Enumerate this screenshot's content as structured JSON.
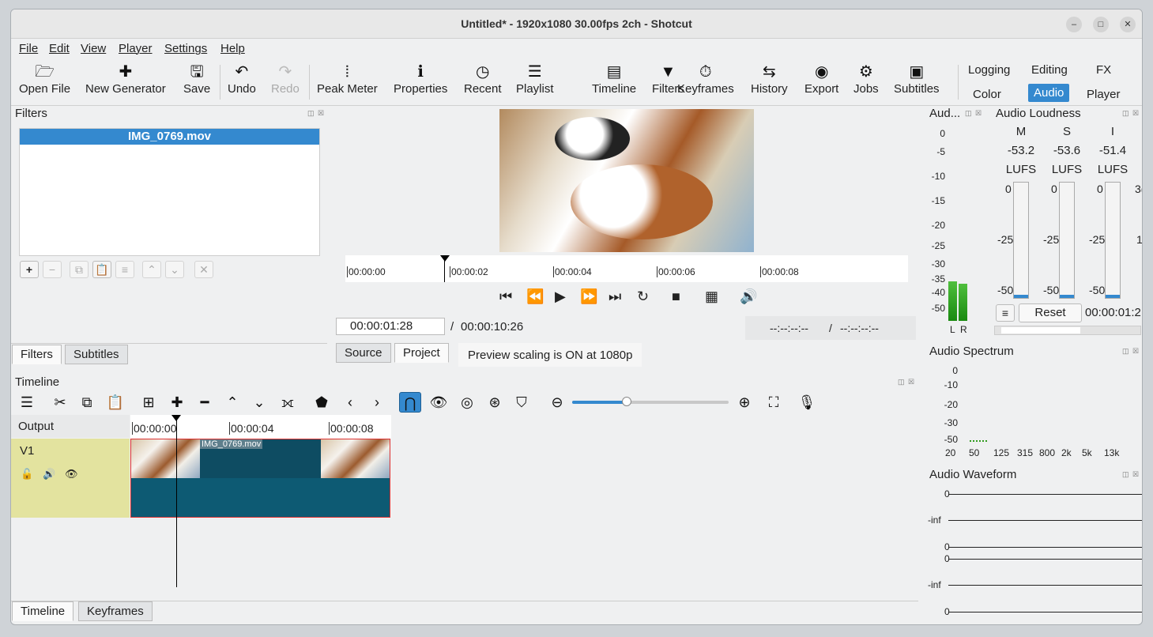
{
  "window": {
    "title": "Untitled* - 1920x1080 30.00fps 2ch - Shotcut"
  },
  "menu": [
    "File",
    "Edit",
    "View",
    "Player",
    "Settings",
    "Help"
  ],
  "toolbar": {
    "open_file": "Open File",
    "new_generator": "New Generator",
    "save": "Save",
    "undo": "Undo",
    "redo": "Redo",
    "peak_meter": "Peak Meter",
    "properties": "Properties",
    "recent": "Recent",
    "playlist": "Playlist",
    "timeline": "Timeline",
    "filters": "Filters",
    "keyframes": "Keyframes",
    "history": "History",
    "export": "Export",
    "jobs": "Jobs",
    "subtitles": "Subtitles"
  },
  "layouts": {
    "logging": "Logging",
    "editing": "Editing",
    "fx": "FX",
    "color": "Color",
    "audio": "Audio",
    "player": "Player",
    "active": "Audio"
  },
  "filters_panel": {
    "title": "Filters",
    "selected_clip": "IMG_0769.mov",
    "tabs": [
      "Filters",
      "Subtitles"
    ]
  },
  "player": {
    "ruler": [
      "00:00:00",
      "00:00:02",
      "00:00:04",
      "00:00:06",
      "00:00:08"
    ],
    "position": "00:00:01:28",
    "slash": "/",
    "duration": "00:00:10:26",
    "in_point": "--:--:--:--",
    "out_point": "--:--:--:--",
    "tabs": [
      "Source",
      "Project"
    ],
    "status": "Preview scaling is ON at 1080p"
  },
  "peak_meter": {
    "title": "Aud...",
    "scale": [
      "0",
      "-5",
      "-10",
      "-15",
      "-20",
      "-25",
      "-30",
      "-35",
      "-40",
      "-50"
    ],
    "channels": [
      "L",
      "R"
    ]
  },
  "loudness": {
    "title": "Audio Loudness",
    "columns": [
      {
        "label": "M",
        "value": "-53.2",
        "unit": "LUFS"
      },
      {
        "label": "S",
        "value": "-53.6",
        "unit": "LUFS"
      },
      {
        "label": "I",
        "value": "-51.4",
        "unit": "LUFS"
      }
    ],
    "scale_top": "0",
    "scale_mid": "-25",
    "scale_low": "-50",
    "extra_top": "3(",
    "extra_mid": "1",
    "reset": "Reset",
    "time": "00:00:01:2"
  },
  "spectrum": {
    "title": "Audio Spectrum",
    "y": [
      "0",
      "-10",
      "-20",
      "-30",
      "-50"
    ],
    "x": [
      "20",
      "50",
      "125",
      "315",
      "800",
      "2k",
      "5k",
      "13k"
    ]
  },
  "waveform": {
    "title": "Audio Waveform",
    "labels": [
      "0",
      "-inf",
      "0",
      "0",
      "-inf",
      "0"
    ]
  },
  "timeline": {
    "title": "Timeline",
    "output": "Output",
    "track": "V1",
    "ruler": [
      "00:00:00",
      "00:00:04",
      "00:00:08"
    ],
    "clip": "IMG_0769.mov",
    "zoom_level": 0.35,
    "tabs": [
      "Timeline",
      "Keyframes"
    ]
  }
}
